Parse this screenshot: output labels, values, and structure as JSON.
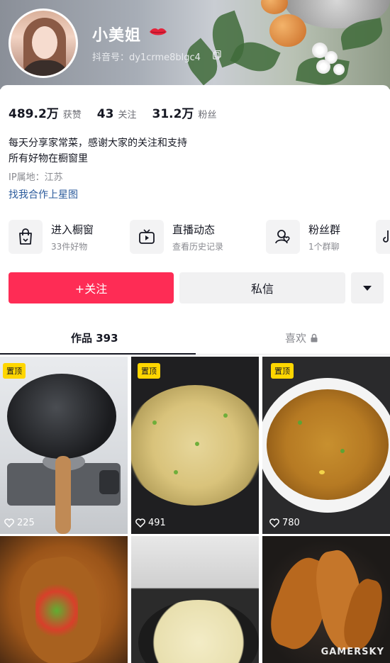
{
  "profile": {
    "name": "小美姐",
    "douyin_id": "抖音号：dy1crme8blgc4"
  },
  "stats": [
    {
      "value": "489.2万",
      "label": "获赞"
    },
    {
      "value": "43",
      "label": "关注"
    },
    {
      "value": "31.2万",
      "label": "粉丝"
    }
  ],
  "bio": {
    "line1": "每天分享家常菜，感谢大家的关注和支持",
    "line2": "所有好物在橱窗里",
    "ip": "IP属地：江苏",
    "star_link": "找我合作上星图"
  },
  "shortcuts": [
    {
      "title": "进入橱窗",
      "subtitle": "33件好物",
      "icon": "shopping-bag-icon"
    },
    {
      "title": "直播动态",
      "subtitle": "查看历史记录",
      "icon": "tv-play-icon"
    },
    {
      "title": "粉丝群",
      "subtitle": "1个群聊",
      "icon": "fan-group-icon"
    }
  ],
  "actions": {
    "follow": "+关注",
    "message": "私信"
  },
  "tabs": {
    "works": "作品 393",
    "likes": "喜欢"
  },
  "videos": [
    {
      "pinned_label": "置顶",
      "likes": "225"
    },
    {
      "pinned_label": "置顶",
      "likes": "491"
    },
    {
      "pinned_label": "置顶",
      "likes": "780"
    },
    {
      "pinned_label": "",
      "likes": ""
    },
    {
      "pinned_label": "",
      "likes": ""
    },
    {
      "pinned_label": "",
      "likes": ""
    }
  ],
  "watermark": "GAMERSKY",
  "colors": {
    "follow_button": "#fe2c55",
    "pin_badge": "#ffd600",
    "link": "#2b5b9c"
  }
}
